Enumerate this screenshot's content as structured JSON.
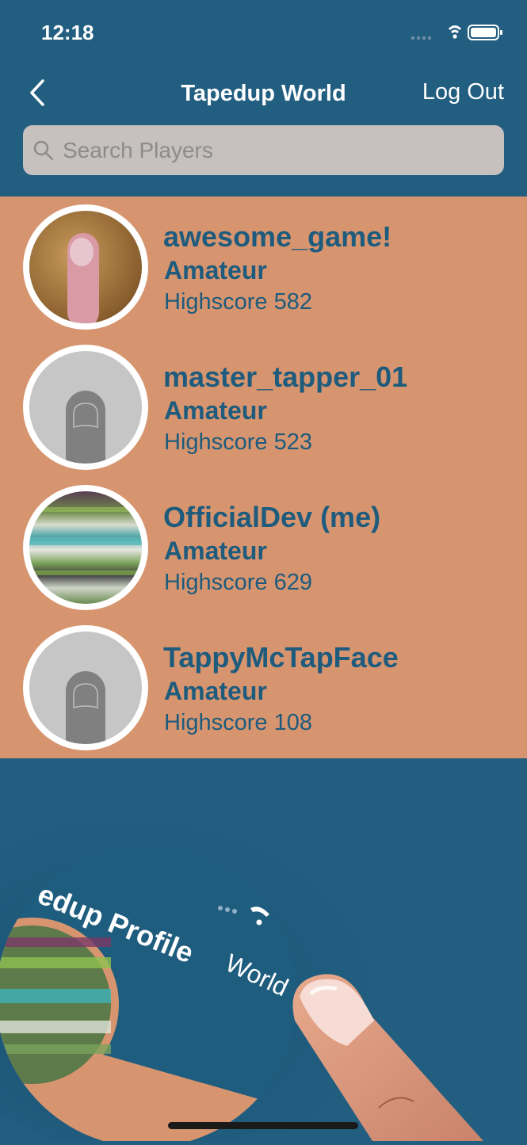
{
  "status_bar": {
    "time": "12:18"
  },
  "nav": {
    "title": "Tapedup World",
    "logout_label": "Log Out"
  },
  "search": {
    "placeholder": "Search Players",
    "value": ""
  },
  "players": [
    {
      "name": "awesome_game!",
      "rank": "Amateur",
      "highscore": "Highscore 582",
      "avatar": "photo-finger"
    },
    {
      "name": "master_tapper_01",
      "rank": "Amateur",
      "highscore": "Highscore 523",
      "avatar": "default-finger-icon"
    },
    {
      "name": "OfficialDev (me)",
      "rank": "Amateur",
      "highscore": "Highscore 629",
      "avatar": "photo-blurred-shelves"
    },
    {
      "name": "TappyMcTapFace",
      "rank": "Amateur",
      "highscore": "Highscore 108",
      "avatar": "default-finger-icon"
    }
  ],
  "tutorial": {
    "zoom_text_profile": "edup Profile",
    "zoom_text_world": "World"
  },
  "colors": {
    "background": "#215e80",
    "list": "#d6956f",
    "text": "#1e5b7d",
    "search": "#c6c0bf"
  }
}
